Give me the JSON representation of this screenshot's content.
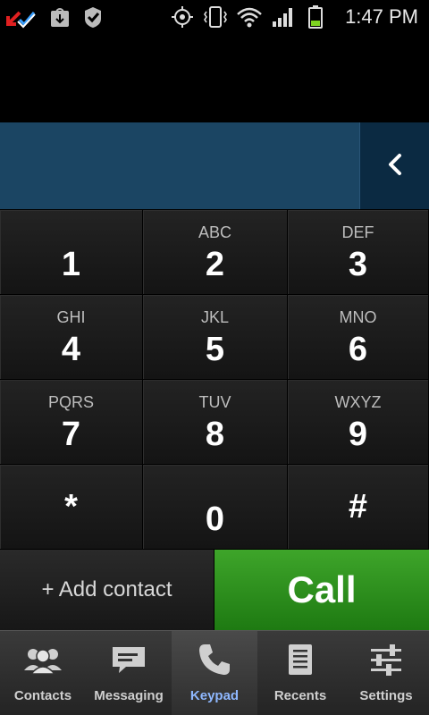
{
  "status_bar": {
    "time": "1:47 PM",
    "icons": [
      "sync-alert-icon",
      "download-store-icon",
      "task-check-icon",
      "gps-icon",
      "vibrate-icon",
      "wifi-icon",
      "signal-icon",
      "battery-icon"
    ],
    "battery_level": 0.35,
    "battery_color": "#7ed321"
  },
  "dialer": {
    "number": "",
    "backspace_icon": "backspace-chevron-icon"
  },
  "keypad": {
    "keys": [
      {
        "digit": "1",
        "letters": ""
      },
      {
        "digit": "2",
        "letters": "ABC"
      },
      {
        "digit": "3",
        "letters": "DEF"
      },
      {
        "digit": "4",
        "letters": "GHI"
      },
      {
        "digit": "5",
        "letters": "JKL"
      },
      {
        "digit": "6",
        "letters": "MNO"
      },
      {
        "digit": "7",
        "letters": "PQRS"
      },
      {
        "digit": "8",
        "letters": "TUV"
      },
      {
        "digit": "9",
        "letters": "WXYZ"
      },
      {
        "digit": "*",
        "letters": ""
      },
      {
        "digit": "0",
        "letters": ""
      },
      {
        "digit": "#",
        "letters": ""
      }
    ]
  },
  "actions": {
    "add_contact": "+ Add contact",
    "call": "Call",
    "call_color": "#2e8f1e"
  },
  "tabs": [
    {
      "label": "Contacts",
      "icon": "contacts-icon",
      "active": false
    },
    {
      "label": "Messaging",
      "icon": "messaging-icon",
      "active": false
    },
    {
      "label": "Keypad",
      "icon": "phone-icon",
      "active": true
    },
    {
      "label": "Recents",
      "icon": "recents-list-icon",
      "active": false
    },
    {
      "label": "Settings",
      "icon": "settings-sliders-icon",
      "active": false
    }
  ],
  "colors": {
    "display_bg": "#1b4563",
    "active_tab_text": "#8fb8ff"
  }
}
